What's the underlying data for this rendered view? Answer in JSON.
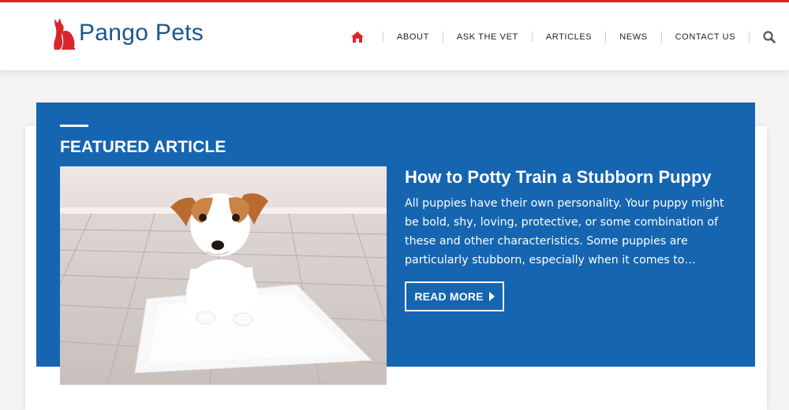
{
  "brand": {
    "name": "Pango Pets",
    "primary_color": "#1b568f",
    "accent_color": "#d9262b"
  },
  "nav": {
    "home_icon": "home-icon",
    "items": [
      {
        "label": "ABOUT"
      },
      {
        "label": "ASK THE VET"
      },
      {
        "label": "ARTICLES"
      },
      {
        "label": "NEWS"
      },
      {
        "label": "CONTACT US"
      }
    ],
    "search_icon": "search-icon"
  },
  "featured": {
    "heading": "FEATURED ARTICLE",
    "background_color": "#1565b1",
    "image_icon": "puppy-on-pad-photo",
    "title": "How to Potty Train a Stubborn Puppy",
    "excerpt": "All puppies have their own personality. Your puppy might be bold, shy, loving, protective, or some combination of these and other characteristics. Some puppies are particularly stubborn, especially when it comes to…",
    "button_label": "READ MORE"
  }
}
